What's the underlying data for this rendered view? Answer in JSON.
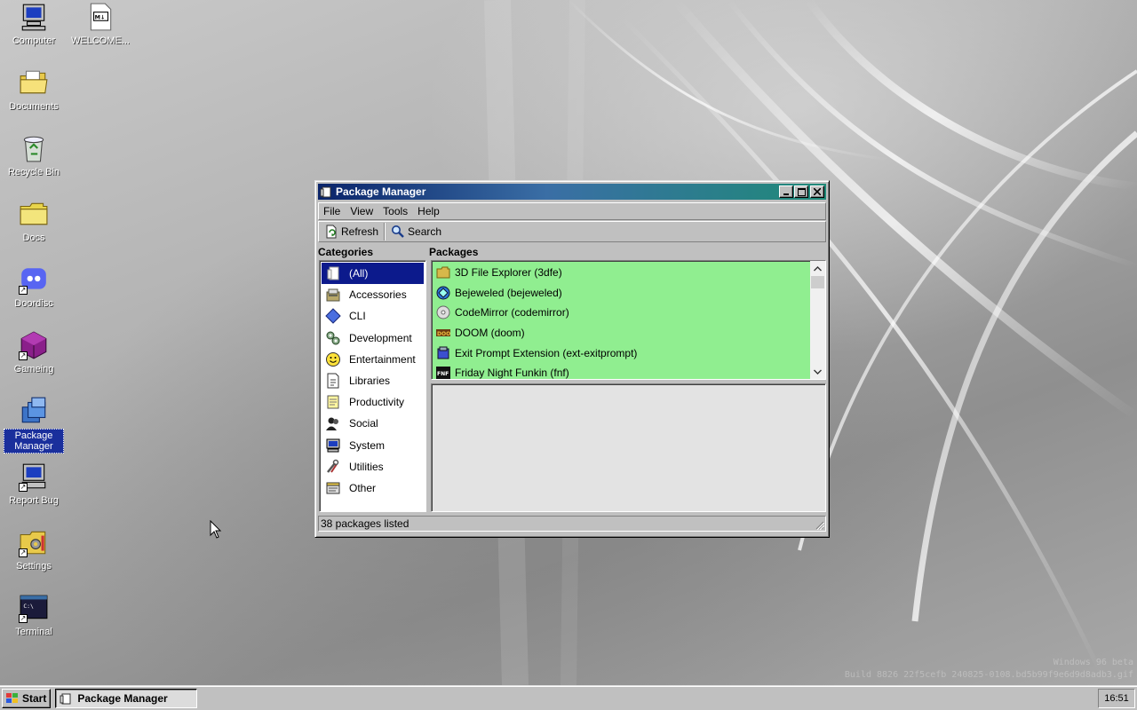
{
  "desktop": {
    "icons": [
      {
        "label": "Computer",
        "icon": "computer-icon"
      },
      {
        "label": "WELCOME...",
        "icon": "markdown-file-icon"
      },
      {
        "label": "Documents",
        "icon": "documents-folder-icon"
      },
      {
        "label": "Recycle Bin",
        "icon": "recycle-bin-icon"
      },
      {
        "label": "Docs",
        "icon": "folder-icon"
      },
      {
        "label": "Doordisc",
        "icon": "doordisc-icon"
      },
      {
        "label": "Gameing",
        "icon": "game-cube-icon"
      },
      {
        "label": "Package Manager",
        "icon": "package-manager-icon"
      },
      {
        "label": "Report Bug",
        "icon": "report-bug-icon"
      },
      {
        "label": "Settings",
        "icon": "settings-icon"
      },
      {
        "label": "Terminal",
        "icon": "terminal-icon"
      }
    ],
    "watermark_line1": "Windows 96 beta",
    "watermark_line2": "Build 8826 22f5cefb 240825-0108.bd5b99f9e6d9d8adb3.gif"
  },
  "window": {
    "title": "Package Manager",
    "menu": [
      "File",
      "View",
      "Tools",
      "Help"
    ],
    "toolbar": {
      "refresh_label": "Refresh",
      "search_label": "Search"
    },
    "categories_label": "Categories",
    "packages_label": "Packages",
    "categories": [
      {
        "label": "(All)",
        "icon": "all-icon",
        "selected": true
      },
      {
        "label": "Accessories",
        "icon": "accessories-icon"
      },
      {
        "label": "CLI",
        "icon": "cli-diamond-icon"
      },
      {
        "label": "Development",
        "icon": "development-gears-icon"
      },
      {
        "label": "Entertainment",
        "icon": "smiley-icon"
      },
      {
        "label": "Libraries",
        "icon": "libraries-icon"
      },
      {
        "label": "Productivity",
        "icon": "productivity-notepad-icon"
      },
      {
        "label": "Social",
        "icon": "social-people-icon"
      },
      {
        "label": "System",
        "icon": "system-computer-icon"
      },
      {
        "label": "Utilities",
        "icon": "utilities-tools-icon"
      },
      {
        "label": "Other",
        "icon": "other-box-icon"
      }
    ],
    "packages": [
      {
        "label": "3D File Explorer (3dfe)",
        "icon": "folder-icon"
      },
      {
        "label": "Bejeweled (bejeweled)",
        "icon": "gem-icon"
      },
      {
        "label": "CodeMirror (codemirror)",
        "icon": "disc-icon"
      },
      {
        "label": "DOOM (doom)",
        "icon": "doom-icon"
      },
      {
        "label": "Exit Prompt Extension (ext-exitprompt)",
        "icon": "extension-icon"
      },
      {
        "label": "Friday Night Funkin (fnf)",
        "icon": "fnf-icon"
      }
    ],
    "package_highlight_color": "#90ee90",
    "status": "38 packages listed"
  },
  "taskbar": {
    "start_label": "Start",
    "task_label": "Package Manager",
    "clock": "16:51"
  }
}
